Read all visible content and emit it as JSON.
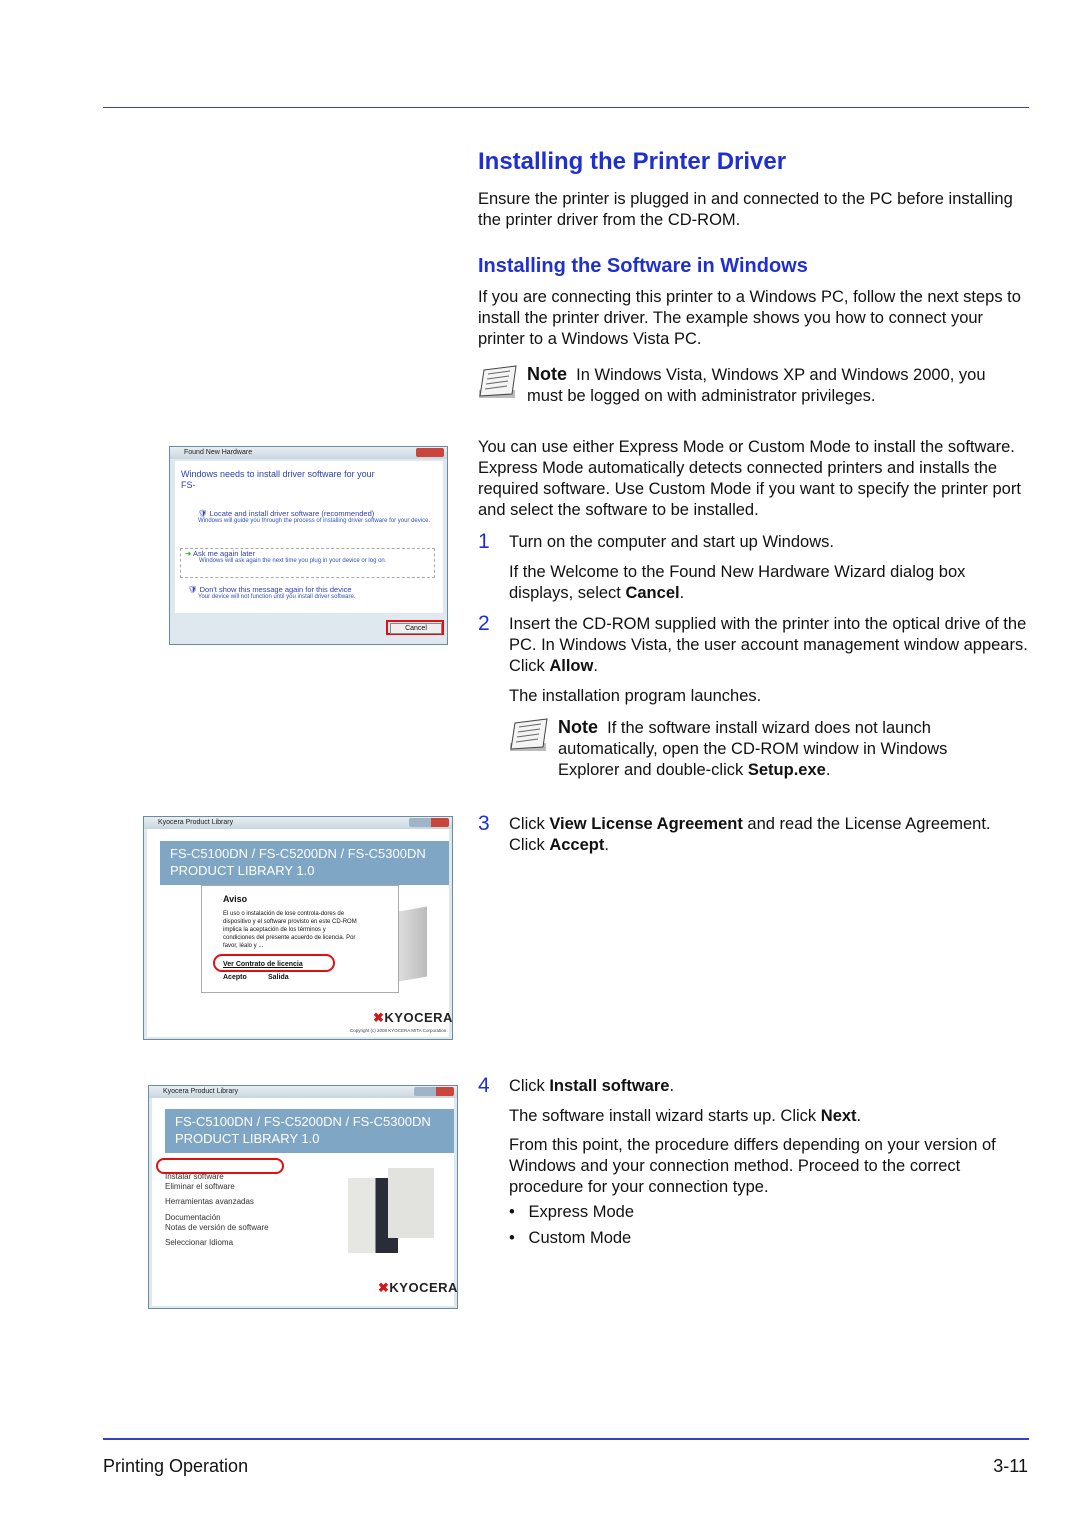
{
  "title": "Installing the Printer Driver",
  "intro": "Ensure the printer is plugged in and connected to the PC before installing the printer driver from the CD-ROM.",
  "subtitle": "Installing the Software in Windows",
  "para1": "If you are connecting this printer to a Windows PC, follow the next steps to install the printer driver. The example shows you how to connect your printer to a Windows Vista PC.",
  "note1": {
    "label": "Note",
    "text": "In Windows Vista, Windows XP and Windows 2000, you must be logged on with administrator privileges."
  },
  "para2": "You can use either Express Mode or Custom Mode to install the software. Express Mode automatically detects connected printers and installs the required software. Use Custom Mode if you want to specify the printer port and select the software to be installed.",
  "steps": [
    {
      "num": "1",
      "text": "Turn on the computer and start up Windows.",
      "sub_pre": "If the Welcome to the Found New Hardware Wizard dialog box displays, select ",
      "sub_bold": "Cancel",
      "sub_post": "."
    },
    {
      "num": "2",
      "text_pre": "Insert the CD-ROM supplied with the printer into the optical drive of the PC. In Windows Vista, the user account management window appears. Click ",
      "text_bold": "Allow",
      "text_post": ".",
      "sub": "The installation program launches.",
      "note": {
        "label": "Note",
        "text_pre": "If the software install wizard does not launch automatically, open the CD-ROM window in Windows Explorer and double-click ",
        "text_bold": "Setup.exe",
        "text_post": "."
      }
    },
    {
      "num": "3",
      "a": "Click ",
      "b": "View License Agreement",
      "c": " and read the License Agreement. Click ",
      "d": "Accept",
      "e": "."
    },
    {
      "num": "4",
      "a": "Click ",
      "b": "Install software",
      "c": ".",
      "sub1_pre": "The software install wizard starts up. Click ",
      "sub1_bold": "Next",
      "sub1_post": ".",
      "sub2": "From this point, the procedure differs depending on your version of Windows and your connection method. Proceed to the correct procedure for your connection type.",
      "bullets": [
        "Express Mode",
        "Custom Mode"
      ]
    }
  ],
  "screens": {
    "hardware": {
      "title": "Found New Hardware",
      "heading": "Windows needs to install driver software for your",
      "device": "FS-",
      "opt1": "Locate and install driver software (recommended)",
      "opt1_desc": "Windows will guide you through the process of installing driver software for your device.",
      "opt2": "Ask me again later",
      "opt2_desc": "Windows will ask again the next time you plug in your device or log on.",
      "opt3": "Don't show this message again for this device",
      "opt3_desc": "Your device will not function until you install driver software.",
      "cancel": "Cancel"
    },
    "license": {
      "title": "Kyocera Product Library",
      "banner1": "FS-C5100DN / FS-C5200DN / FS-C5300DN",
      "banner2": "PRODUCT LIBRARY 1.0",
      "aviso": "Aviso",
      "body": "El uso o instalación de lose controla-dores de dispositivo y el software provisto en este CD-ROM implica la aceptación de los términos y condiciones del presente acuerdo de licencia. Por favor, léalo y ... ",
      "link": "Ver Contrato de licencia",
      "accept": "Acepto",
      "exit": "Salida",
      "logo": "KYOCERA",
      "copyright": "Copyright (c) 2008 KYOCERA MITA Corporation"
    },
    "library": {
      "title": "Kyocera Product Library",
      "banner1": "FS-C5100DN / FS-C5200DN / FS-C5300DN",
      "banner2": "PRODUCT LIBRARY 1.0",
      "items": [
        "Instalar software",
        "Eliminar el software",
        "Herramientas avanzadas",
        "Documentación",
        "Notas de versión de software",
        "Seleccionar Idioma"
      ],
      "logo": "KYOCERA"
    }
  },
  "footer": {
    "left": "Printing Operation",
    "right": "3-11"
  },
  "colors": {
    "heading": "#2030d0",
    "rule": "#3340c8",
    "highlight": "#e01010"
  }
}
